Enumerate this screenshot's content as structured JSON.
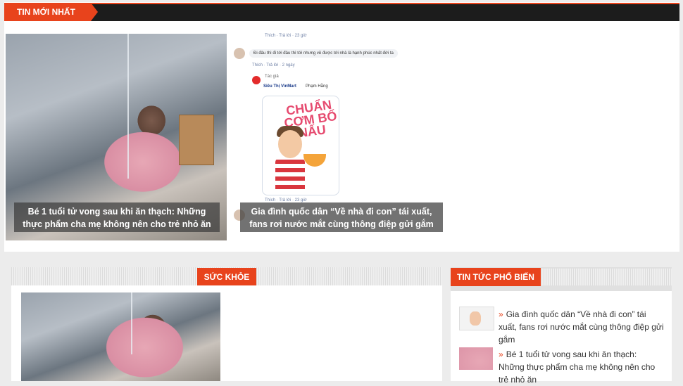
{
  "latest": {
    "heading": "TIN MỚI NHẤT",
    "items": [
      {
        "caption": "Bé 1 tuổi tử vong sau khi ăn thạch: Những thực phẩm cha mẹ không nên cho trẻ nhỏ ăn"
      },
      {
        "caption": "Gia đình quốc dân “Về nhà đi con” tái xuất, fans rơi nước mắt cùng thông điệp gửi gắm"
      }
    ]
  },
  "fb_screenshot": {
    "row1_meta": "Thích · Trả lời · 23 giờ",
    "row2_text": "Đi đâu thì đi tới đâu thì tới nhưng về được tới nhà là hạnh phúc nhất đời ta",
    "row2_meta": "Thích · Trả lời · 2 ngày",
    "author_tag": "Tác giả",
    "author_name": "Siêu Thị VinMart",
    "author_mention": "Phạm Hằng",
    "sticker_text": "CHUẨN CƠM BỐ NẤU",
    "row3_meta": "Thích · Trả lời · 23 giờ"
  },
  "health": {
    "heading": "SỨC KHỎE"
  },
  "popular": {
    "heading": "TIN TỨC PHỔ BIẾN",
    "items": [
      {
        "title": "Gia đình quốc dân “Về nhà đi con” tái xuất, fans rơi nước mắt cùng thông điệp gửi gắm"
      },
      {
        "title": "Bé 1 tuổi tử vong sau khi ăn thạch: Những thực phẩm cha mẹ không nên cho trẻ nhỏ ăn"
      }
    ]
  }
}
